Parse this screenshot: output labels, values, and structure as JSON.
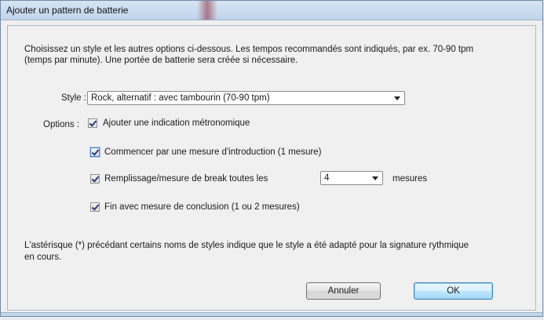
{
  "window": {
    "title": "Ajouter un pattern de batterie"
  },
  "dialog": {
    "intro_line1": "Choisissez un style et les autres options ci-dessous. Les tempos recommandés sont indiqués, par ex. 70-90 tpm",
    "intro_line2": "(temps par minute). Une portée de batterie sera créée si nécessaire.",
    "style_label": "Style :",
    "style_value": "Rock, alternatif : avec tambourin (70-90 tpm)",
    "options_label": "Options :",
    "options": [
      {
        "label": "Ajouter une indication métronomique",
        "checked": true
      },
      {
        "label": "Commencer par une mesure d'introduction (1 mesure)",
        "checked": true
      },
      {
        "label": "Remplissage/mesure de break toutes les",
        "checked": true
      },
      {
        "label": "Fin avec mesure de conclusion (1 ou 2 mesures)",
        "checked": true
      }
    ],
    "fill_every_value": "4",
    "fill_every_unit": "mesures",
    "footer_line1": "L'astérisque (*) précédant certains noms de styles indique que le style a été adapté pour la signature rythmique",
    "footer_line2": "en cours.",
    "cancel_label": "Annuler",
    "ok_label": "OK"
  }
}
